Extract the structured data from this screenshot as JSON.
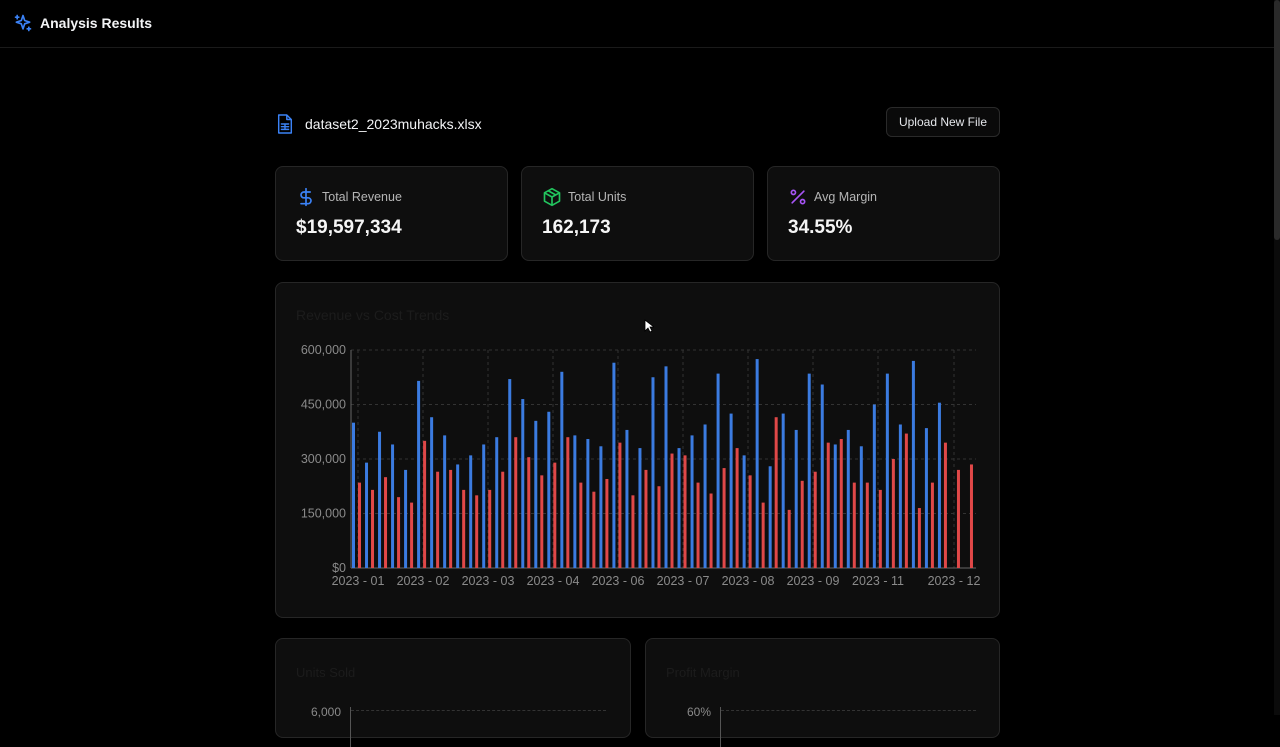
{
  "header": {
    "title": "Analysis Results",
    "logo_icon": "sparkles-icon"
  },
  "file": {
    "name": "dataset2_2023muhacks.xlsx",
    "icon": "file-spreadsheet-icon",
    "upload_label": "Upload New File"
  },
  "stats": [
    {
      "label": "Total Revenue",
      "value": "$19,597,334",
      "icon": "dollar-icon",
      "color": "#3b82f6"
    },
    {
      "label": "Total Units",
      "value": "162,173",
      "icon": "box-icon",
      "color": "#22c55e"
    },
    {
      "label": "Avg Margin",
      "value": "34.55%",
      "icon": "percent-icon",
      "color": "#a855f7"
    }
  ],
  "colors": {
    "revenue": "#3b7be0",
    "cost": "#e04848"
  },
  "chart_data": {
    "type": "bar",
    "title": "Revenue vs Cost Trends",
    "xlabel": "",
    "ylabel": "",
    "ylim": [
      0,
      600000
    ],
    "yticks": [
      "$0",
      "150,000",
      "300,000",
      "450,000",
      "600,000"
    ],
    "xticks": [
      "2023 - 01",
      "2023 - 02",
      "2023 - 03",
      "2023 - 04",
      "2023 - 06",
      "2023 - 07",
      "2023 - 08",
      "2023 - 09",
      "2023 - 11",
      "2023 - 12"
    ],
    "grid": true,
    "series": [
      {
        "values": [
          400000,
          290000,
          375000,
          340000,
          270000,
          515000,
          415000,
          365000,
          285000,
          310000,
          340000,
          360000,
          520000,
          465000,
          405000,
          430000,
          540000,
          365000,
          355000,
          335000,
          565000,
          380000,
          330000,
          525000,
          555000,
          330000,
          365000,
          395000,
          535000,
          425000,
          310000,
          575000,
          280000,
          425000,
          380000,
          535000,
          505000,
          340000,
          380000,
          335000,
          450000,
          535000,
          395000,
          570000,
          385000,
          455000
        ]
      },
      {
        "values": [
          235000,
          215000,
          250000,
          195000,
          180000,
          350000,
          265000,
          270000,
          215000,
          200000,
          215000,
          265000,
          360000,
          305000,
          255000,
          290000,
          360000,
          235000,
          210000,
          245000,
          345000,
          200000,
          270000,
          225000,
          315000,
          310000,
          235000,
          205000,
          275000,
          330000,
          255000,
          180000,
          415000,
          160000,
          240000,
          265000,
          345000,
          355000,
          235000,
          235000,
          215000,
          300000,
          370000,
          165000,
          235000,
          345000,
          270000,
          285000
        ]
      }
    ]
  },
  "sub_charts": [
    {
      "title": "Units Sold",
      "y_top": "6,000"
    },
    {
      "title": "Profit Margin",
      "y_top": "60%"
    }
  ]
}
